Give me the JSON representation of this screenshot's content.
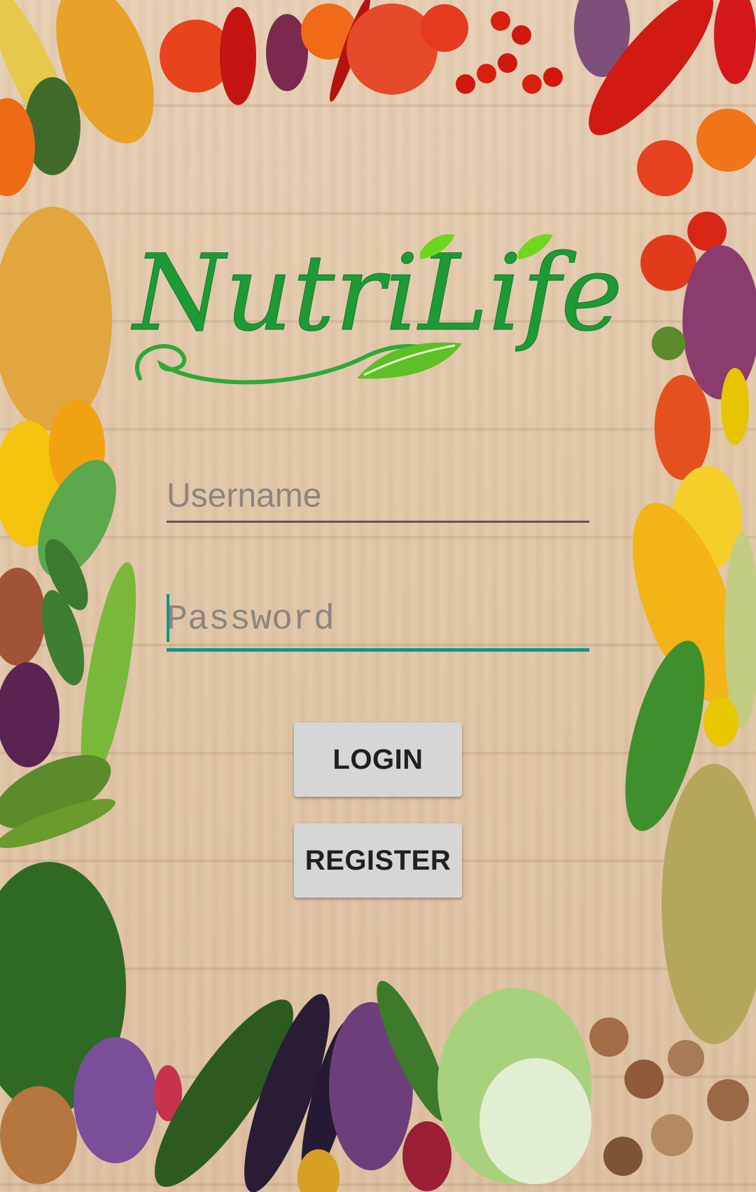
{
  "app": {
    "logo_text": "NutriLife"
  },
  "login_form": {
    "username_placeholder": "Username",
    "username_value": "",
    "password_placeholder": "Password",
    "password_value": ""
  },
  "buttons": {
    "login_label": "LOGIN",
    "register_label": "REGISTER"
  },
  "colors": {
    "accent": "#109688",
    "logo_green": "#1d9a36",
    "leaf_green": "#6fd61f",
    "button_bg": "#d6d6d6"
  }
}
